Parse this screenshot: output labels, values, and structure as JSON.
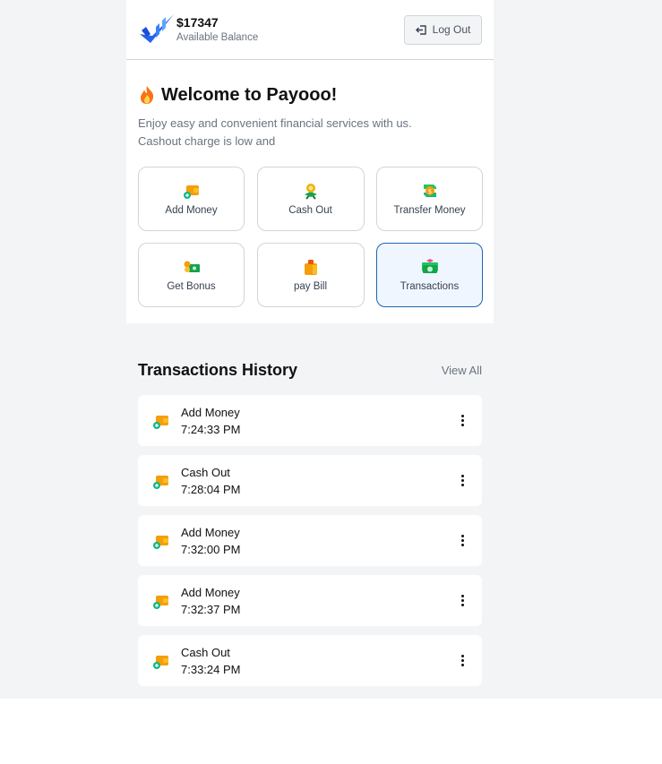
{
  "header": {
    "balance_amount": "$17347",
    "balance_label": "Available Balance",
    "logout_label": "Log Out",
    "logo_icon": "payooo-check-logo",
    "logout_icon": "logout-arrow-icon"
  },
  "welcome": {
    "title": "Welcome to Payooo!",
    "title_icon": "flame-icon",
    "description_line1": "Enjoy easy and convenient financial services with us.",
    "description_line2": "Cashout charge is low and"
  },
  "actions": [
    {
      "label": "Add Money",
      "icon": "wallet-add-icon",
      "active": false
    },
    {
      "label": "Cash Out",
      "icon": "cash-flower-icon",
      "active": false
    },
    {
      "label": "Transfer Money",
      "icon": "transfer-icon",
      "active": false
    },
    {
      "label": "Get Bonus",
      "icon": "bonus-money-icon",
      "active": false
    },
    {
      "label": "pay Bill",
      "icon": "bill-bag-icon",
      "active": false
    },
    {
      "label": "Transactions",
      "icon": "money-stack-icon",
      "active": true
    }
  ],
  "history": {
    "title": "Transactions History",
    "view_all_label": "View All",
    "items": [
      {
        "type": "Add Money",
        "time": "7:24:33 PM"
      },
      {
        "type": "Cash Out",
        "time": "7:28:04 PM"
      },
      {
        "type": "Add Money",
        "time": "7:32:00 PM"
      },
      {
        "type": "Add Money",
        "time": "7:32:37 PM"
      },
      {
        "type": "Cash Out",
        "time": "7:33:24 PM"
      }
    ]
  },
  "colors": {
    "accent": "#1e66b0",
    "active_card_bg": "#eff6ff",
    "page_bg": "#f3f4f6"
  }
}
